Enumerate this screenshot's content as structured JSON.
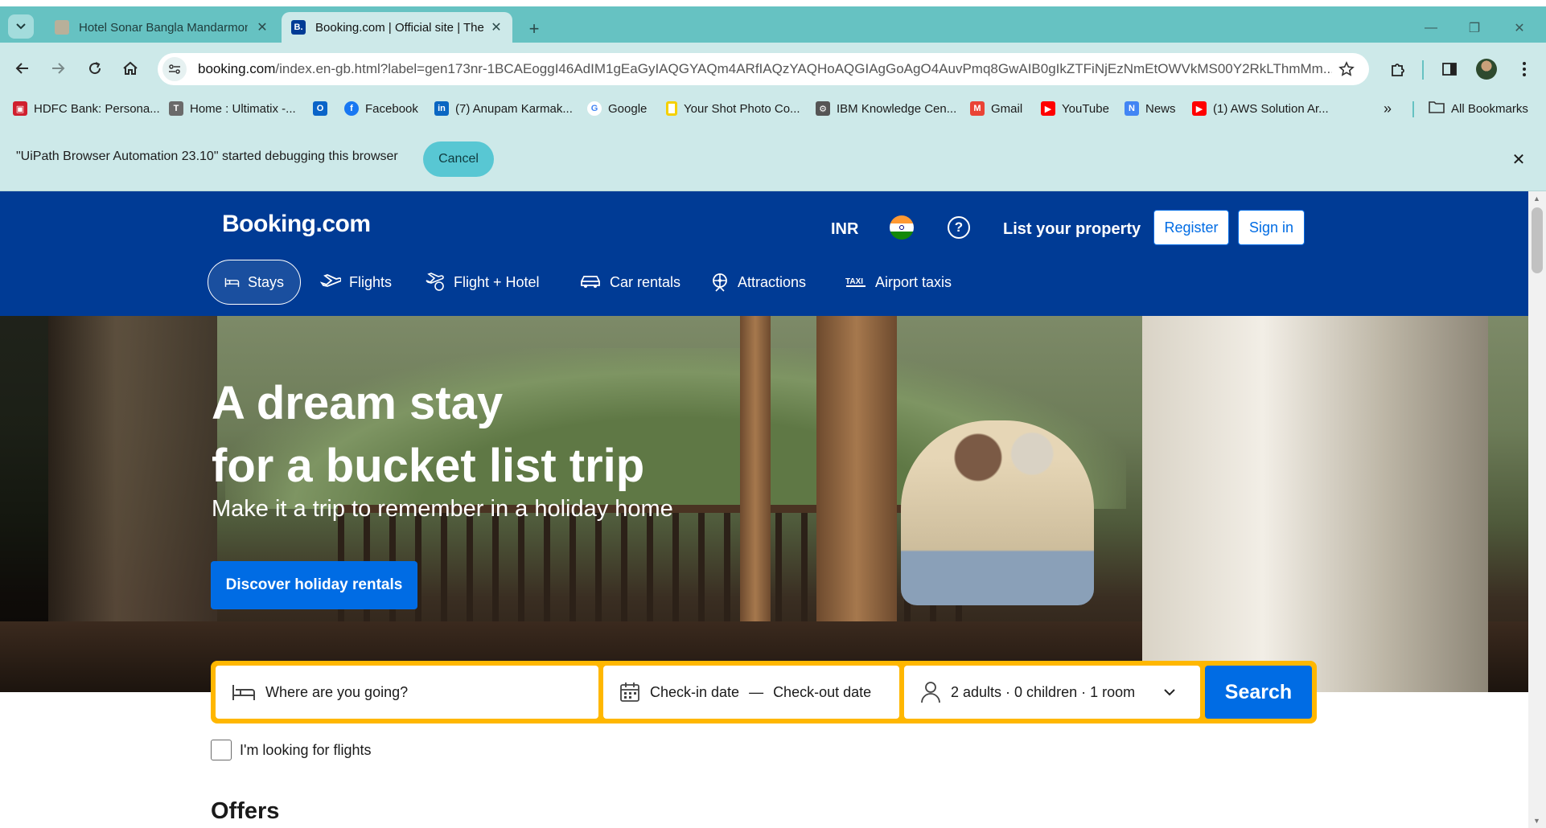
{
  "browser": {
    "tabs": [
      {
        "title": "Hotel Sonar Bangla Mandarmoni",
        "active": false,
        "favicon": "hotel-favicon"
      },
      {
        "title": "Booking.com | Official site | The",
        "active": true,
        "favicon": "booking-favicon",
        "favicon_text": "B."
      }
    ],
    "url": {
      "host": "booking.com",
      "path": "/index.en-gb.html?label=gen173nr-1BCAEoggI46AdIM1gEaGyIAQGYAQm4ARfIAQzYAQHoAQGIAgGoAgO4AuvPmq8GwAIB0gIkZTFiNjEzNmEtOWVkMS00Y2RkLThmMm..."
    },
    "bookmarks": [
      {
        "label": "HDFC Bank: Persona...",
        "color": "#d01f2e",
        "icon": "hdfc-icon"
      },
      {
        "label": "Home : Ultimatix -...",
        "color": "#6a6a6a",
        "icon": "tata-icon"
      },
      {
        "label": "",
        "color": "#0a64c8",
        "icon": "outlook-icon"
      },
      {
        "label": "Facebook",
        "color": "#1877f2",
        "icon": "facebook-icon"
      },
      {
        "label": "(7) Anupam Karmak...",
        "color": "#0a66c2",
        "icon": "linkedin-icon"
      },
      {
        "label": "Google",
        "color": "#4285f4",
        "icon": "google-icon"
      },
      {
        "label": "Your Shot Photo Co...",
        "color": "#f5d000",
        "icon": "natgeo-icon"
      },
      {
        "label": "IBM Knowledge Cen...",
        "color": "#555555",
        "icon": "ibm-icon"
      },
      {
        "label": "Gmail",
        "color": "#ea4335",
        "icon": "gmail-icon"
      },
      {
        "label": "YouTube",
        "color": "#ff0000",
        "icon": "youtube-icon"
      },
      {
        "label": "News",
        "color": "#4285f4",
        "icon": "news-icon"
      },
      {
        "label": "(1) AWS Solution Ar...",
        "color": "#ff0000",
        "icon": "youtube-icon"
      }
    ],
    "bookmarks_more": "»",
    "all_bookmarks": "All Bookmarks",
    "infobar": {
      "text": "\"UiPath Browser Automation 23.10\" started debugging this browser",
      "cancel": "Cancel"
    }
  },
  "header": {
    "logo": "Booking.com",
    "currency": "INR",
    "list_property": "List your property",
    "register": "Register",
    "sign_in": "Sign in",
    "nav": [
      {
        "label": "Stays",
        "icon": "bed-icon",
        "selected": true
      },
      {
        "label": "Flights",
        "icon": "plane-icon",
        "selected": false
      },
      {
        "label": "Flight + Hotel",
        "icon": "flight-hotel-icon",
        "selected": false
      },
      {
        "label": "Car rentals",
        "icon": "car-icon",
        "selected": false
      },
      {
        "label": "Attractions",
        "icon": "attractions-icon",
        "selected": false
      },
      {
        "label": "Airport taxis",
        "icon": "taxi-icon",
        "selected": false
      }
    ]
  },
  "hero": {
    "title_line1": "A dream stay",
    "title_line2": "for a bucket list trip",
    "subtitle": "Make it a trip to remember in a holiday home",
    "cta": "Discover holiday rentals"
  },
  "search": {
    "destination_placeholder": "Where are you going?",
    "checkin": "Check-in date",
    "separator": "—",
    "checkout": "Check-out date",
    "occupancy": "2 adults · 0 children · 1 room",
    "button": "Search"
  },
  "flights_checkbox": {
    "label": "I'm looking for flights",
    "checked": false
  },
  "offers_heading": "Offers",
  "colors": {
    "brand_blue": "#003b95",
    "accent_blue": "#006ce4",
    "search_border": "#ffb700",
    "chrome_teal": "#66c2c2"
  }
}
